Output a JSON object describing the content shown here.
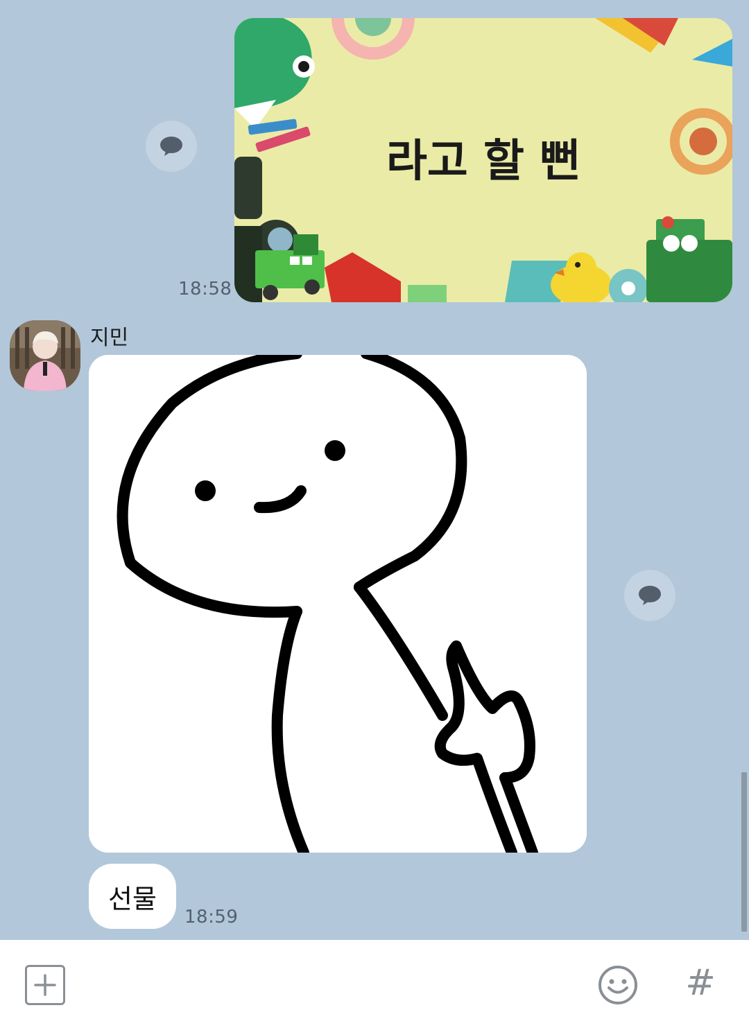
{
  "messages": {
    "sent": {
      "image_text": "라고 할 뻔",
      "time": "18:58"
    },
    "received": {
      "sender_name": "지민",
      "text": "선물",
      "time": "18:59"
    }
  },
  "input_bar": {
    "hash_label": "#"
  },
  "icons": {
    "reply": "speech-bubble-icon",
    "attach": "plus-square-icon",
    "emoji": "smiley-icon",
    "hashtag": "hash-icon"
  },
  "colors": {
    "chat_background": "#b2c7da",
    "bubble": "#ffffff",
    "icon_gray": "#8a8f96"
  }
}
